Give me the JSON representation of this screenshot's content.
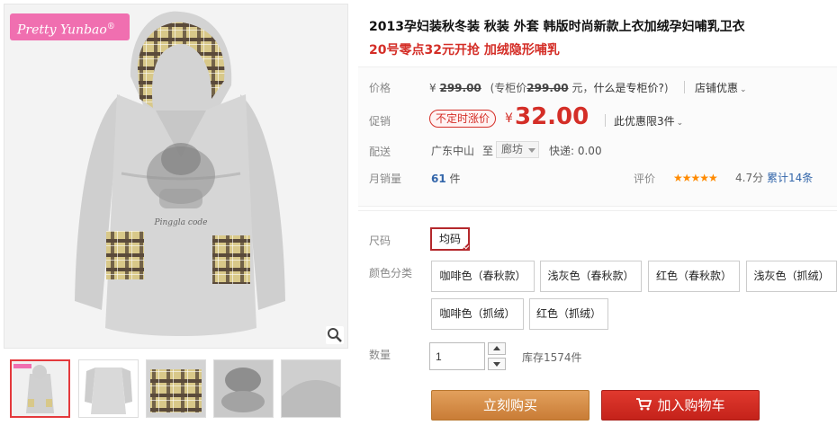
{
  "gallery": {
    "brand_logo": "Pretty Yunbao",
    "brand_mark": "®",
    "garment_print": "Pinggla code",
    "thumbnails": [
      "thumb-front",
      "thumb-back",
      "thumb-pocket-detail",
      "thumb-print-detail",
      "thumb-fabric-detail"
    ]
  },
  "product": {
    "title": "2013孕妇装秋冬装 秋装 外套 韩版时尚新款上衣加绒孕妇哺乳卫衣",
    "subtitle": "20号零点32元开抢 加绒隐形哺乳"
  },
  "price": {
    "label": "价格",
    "yen": "¥",
    "original": "299.00",
    "counter_prefix": "(专柜价",
    "counter_price": "299.00",
    "counter_suffix": "元，",
    "counter_link": "什么是专柜价?",
    "counter_close": ")",
    "shop_offer": "店铺优惠"
  },
  "promo": {
    "label": "促销",
    "tag": "不定时涨价",
    "yen": "¥",
    "price": "32.00",
    "limit": "此优惠限3件"
  },
  "shipping": {
    "label": "配送",
    "origin": "广东中山",
    "to": "至",
    "destination": "廊坊",
    "express": "快递: 0.00"
  },
  "sales": {
    "label": "月销量",
    "count": "61",
    "unit": "件",
    "rating_label": "评价",
    "stars": "★★★★★",
    "score": "4.7分",
    "reviews": "累计14条"
  },
  "size": {
    "label": "尺码",
    "options": [
      "均码"
    ],
    "selected": "均码"
  },
  "color": {
    "label": "颜色分类",
    "options": [
      "咖啡色（春秋款）",
      "浅灰色（春秋款）",
      "红色（春秋款）",
      "浅灰色（抓绒）",
      "咖啡色（抓绒）",
      "红色（抓绒）"
    ]
  },
  "quantity": {
    "label": "数量",
    "value": "1",
    "stock": "库存1574件"
  },
  "actions": {
    "buy_now": "立刻购买",
    "add_cart": "加入购物车"
  },
  "colors": {
    "accent_red": "#d42e27",
    "buy_orange": "#d78d48",
    "cart_red": "#d0291f",
    "link_blue": "#3366aa",
    "star_orange": "#ff8a00",
    "brand_pink": "#f06fb0"
  }
}
